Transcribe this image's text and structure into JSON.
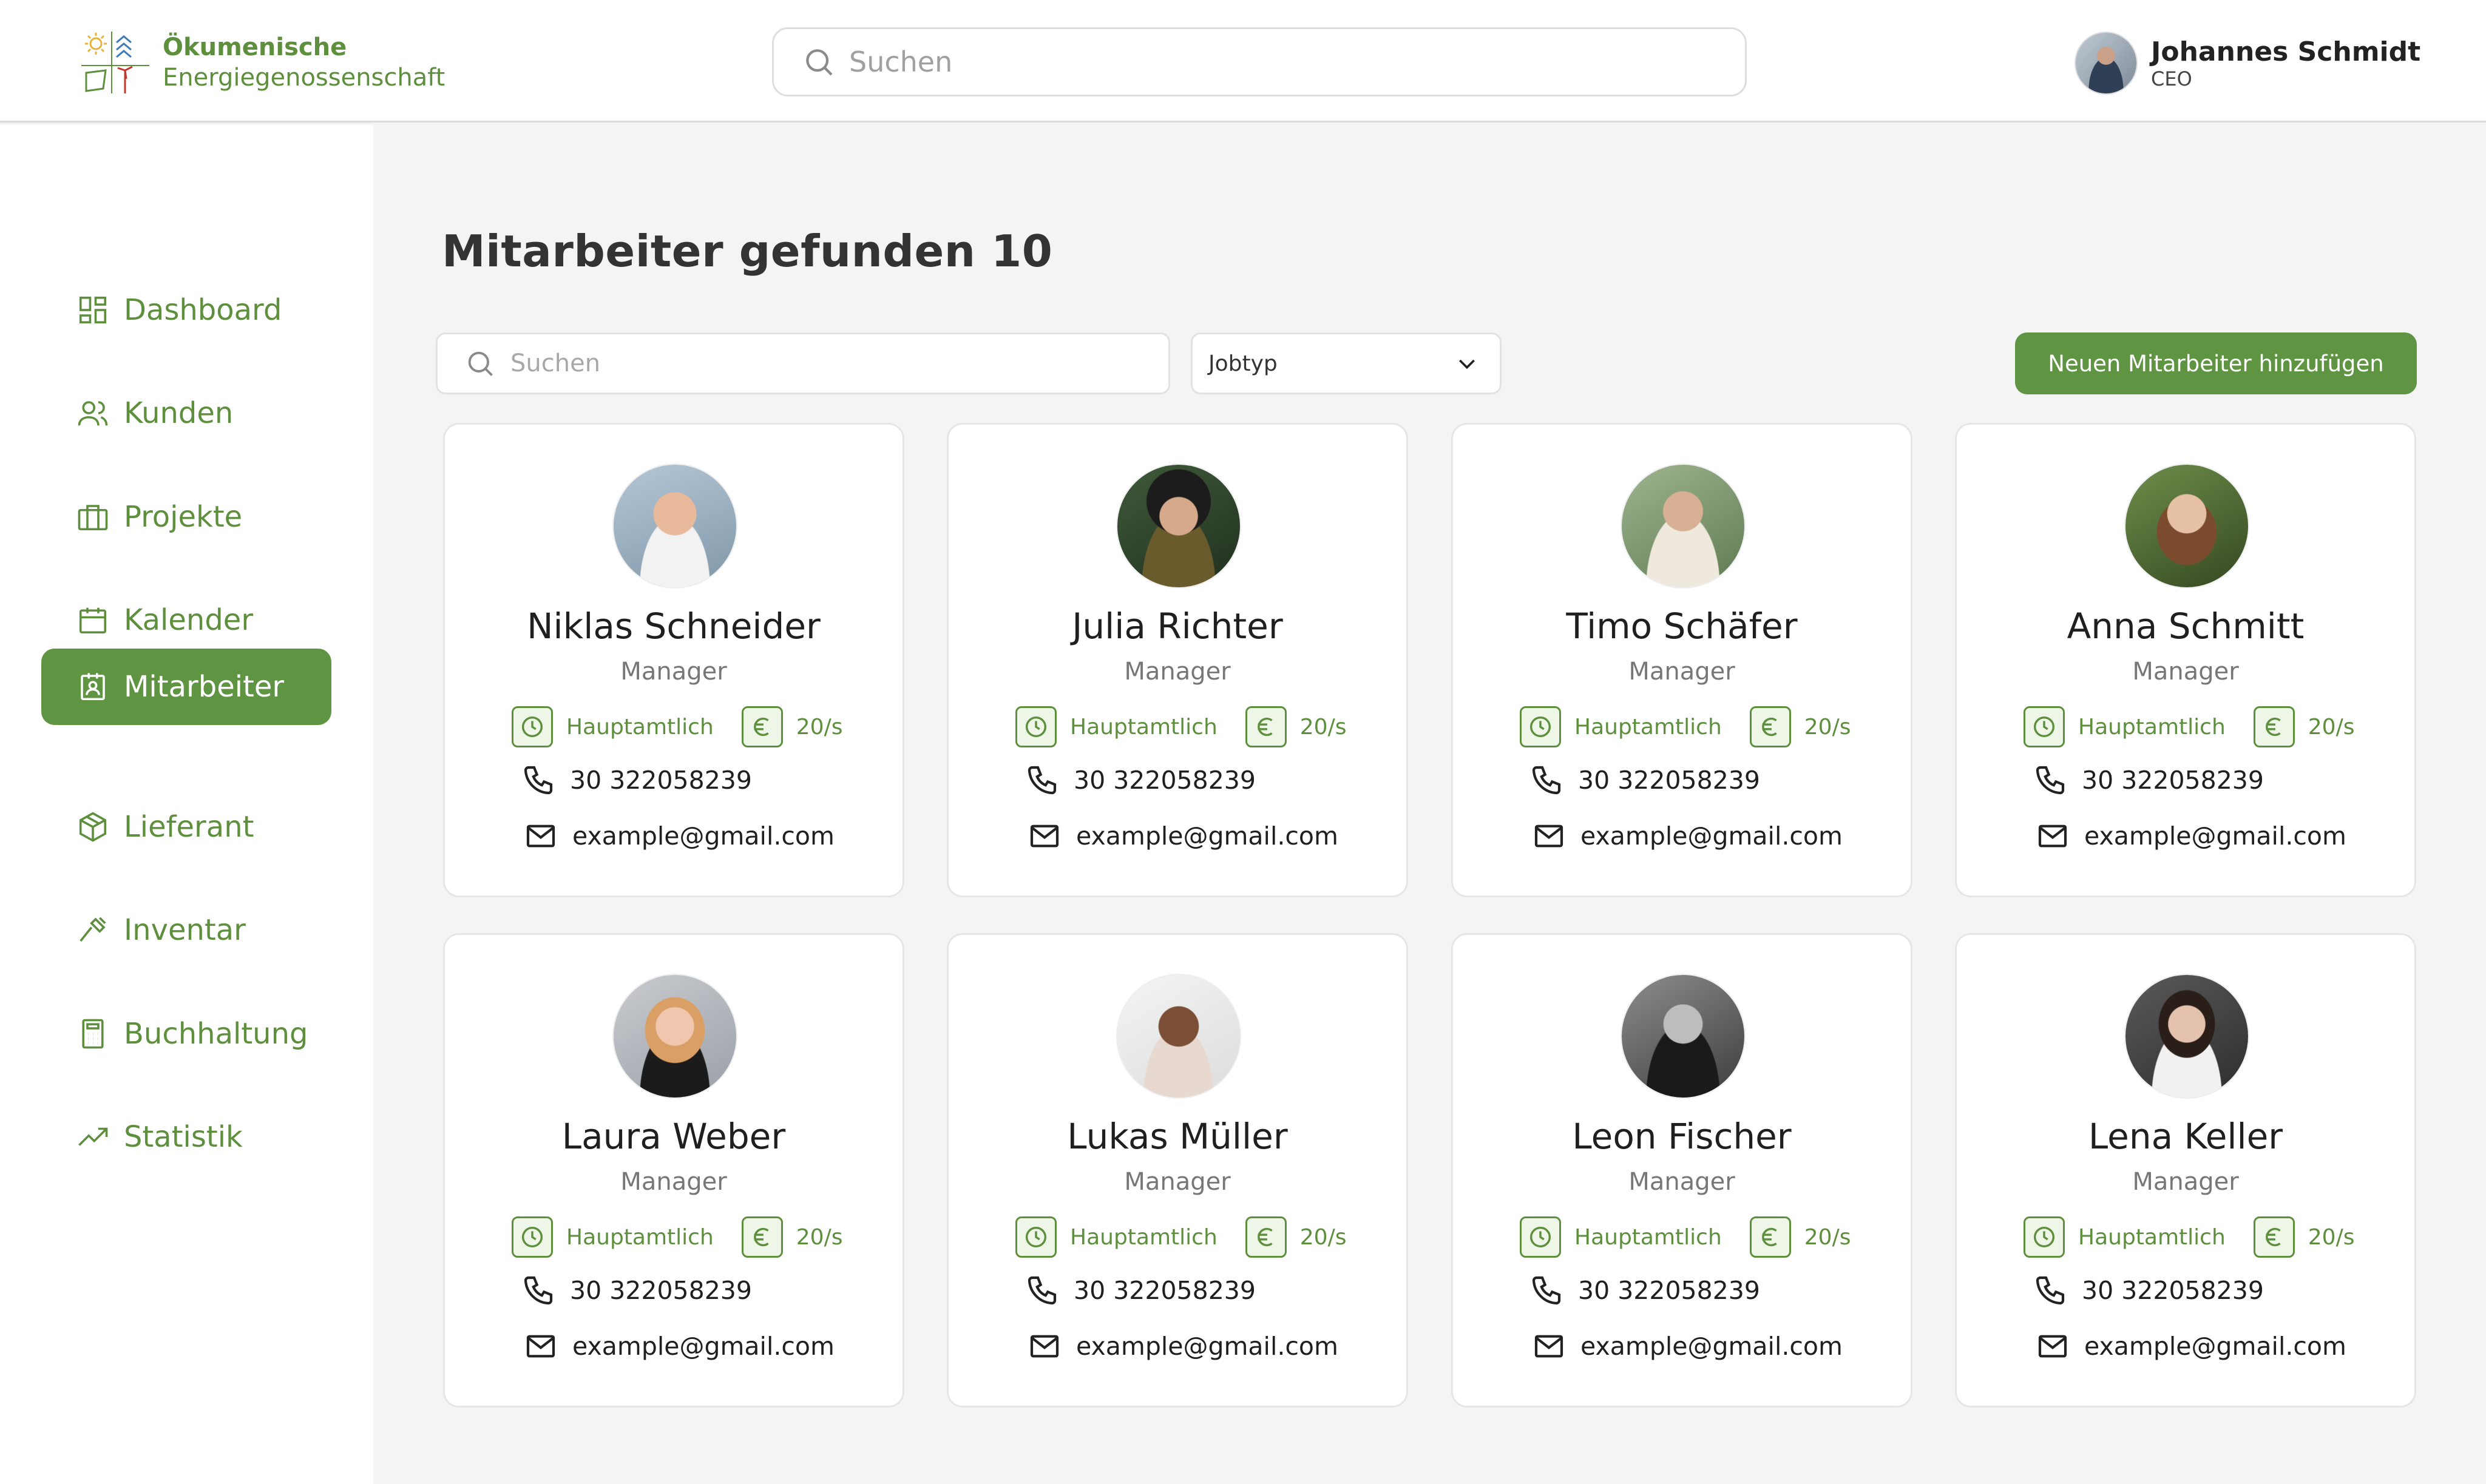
{
  "brand": {
    "line1": "Ökumenische",
    "line2": "Energiegenossenschaft"
  },
  "header": {
    "search_placeholder": "Suchen"
  },
  "user": {
    "name": "Johannes Schmidt",
    "role": "CEO"
  },
  "sidebar": {
    "items": [
      {
        "label": "Dashboard",
        "icon": "dashboard-icon",
        "active": false
      },
      {
        "label": "Kunden",
        "icon": "users-icon",
        "active": false
      },
      {
        "label": "Projekte",
        "icon": "briefcase-icon",
        "active": false
      },
      {
        "label": "Kalender",
        "icon": "calendar-icon",
        "active": false
      },
      {
        "label": "Mitarbeiter",
        "icon": "badge-icon",
        "active": true
      },
      {
        "label": "Lieferant",
        "icon": "box-icon",
        "active": false
      },
      {
        "label": "Inventar",
        "icon": "tool-icon",
        "active": false
      },
      {
        "label": "Buchhaltung",
        "icon": "calculator-icon",
        "active": false
      },
      {
        "label": "Statistik",
        "icon": "trending-up-icon",
        "active": false
      }
    ]
  },
  "main": {
    "title": "Mitarbeiter gefunden 10",
    "search_placeholder": "Suchen",
    "jobtype_label": "Jobtyp",
    "add_button": "Neuen Mitarbeiter hinzufügen"
  },
  "employees": [
    {
      "name": "Niklas Schneider",
      "role": "Manager",
      "type": "Hauptamtlich",
      "rate": "20/s",
      "phone": "30 322058239",
      "email": "example@gmail.com"
    },
    {
      "name": "Julia Richter",
      "role": "Manager",
      "type": "Hauptamtlich",
      "rate": "20/s",
      "phone": "30 322058239",
      "email": "example@gmail.com"
    },
    {
      "name": "Timo Schäfer",
      "role": "Manager",
      "type": "Hauptamtlich",
      "rate": "20/s",
      "phone": "30 322058239",
      "email": "example@gmail.com"
    },
    {
      "name": "Anna Schmitt",
      "role": "Manager",
      "type": "Hauptamtlich",
      "rate": "20/s",
      "phone": "30 322058239",
      "email": "example@gmail.com"
    },
    {
      "name": "Laura Weber",
      "role": "Manager",
      "type": "Hauptamtlich",
      "rate": "20/s",
      "phone": "30 322058239",
      "email": "example@gmail.com"
    },
    {
      "name": "Lukas Müller",
      "role": "Manager",
      "type": "Hauptamtlich",
      "rate": "20/s",
      "phone": "30 322058239",
      "email": "example@gmail.com"
    },
    {
      "name": "Leon Fischer",
      "role": "Manager",
      "type": "Hauptamtlich",
      "rate": "20/s",
      "phone": "30 322058239",
      "email": "example@gmail.com"
    },
    {
      "name": "Lena Keller",
      "role": "Manager",
      "type": "Hauptamtlich",
      "rate": "20/s",
      "phone": "30 322058239",
      "email": "example@gmail.com"
    }
  ],
  "colors": {
    "accent": "#5f9443",
    "accent_text": "#5d8f3d",
    "background": "#f4f4f5"
  }
}
